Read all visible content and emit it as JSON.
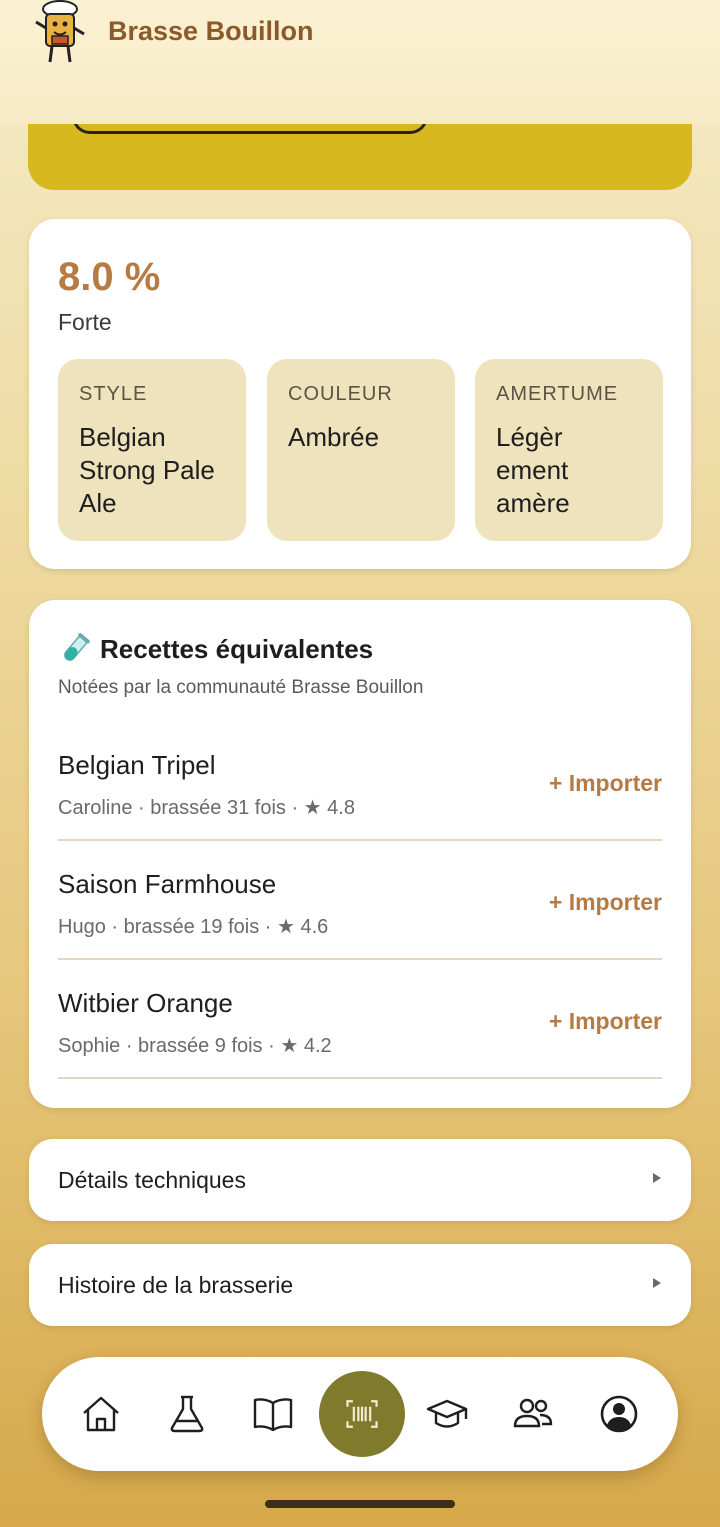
{
  "app": {
    "title": "Brasse Bouillon"
  },
  "beer": {
    "abv": "8.0 %",
    "strength": "Forte",
    "attributes": [
      {
        "label": "STYLE",
        "value": "Belgian Strong Pale Ale"
      },
      {
        "label": "COULEUR",
        "value": "Ambrée"
      },
      {
        "label": "AMERTUME",
        "value": "Légèr ement amère"
      }
    ]
  },
  "recipes": {
    "title": "Recettes équivalentes",
    "subtitle": "Notées par la communauté Brasse Bouillon",
    "import_label": "+ Importer",
    "items": [
      {
        "name": "Belgian Tripel",
        "meta": "Caroline · brassée 31 fois · ★ 4.8"
      },
      {
        "name": "Saison Farmhouse",
        "meta": "Hugo · brassée 19 fois · ★ 4.6"
      },
      {
        "name": "Witbier Orange",
        "meta": "Sophie · brassée 9 fois · ★ 4.2"
      }
    ]
  },
  "sections": {
    "technical": "Détails techniques",
    "history": "Histoire de la brasserie"
  },
  "nav": {
    "items": [
      "home-icon",
      "flask-icon",
      "book-icon",
      "barcode-scan-icon",
      "graduation-cap-icon",
      "community-icon",
      "profile-icon"
    ],
    "active": "barcode-scan-icon"
  },
  "colors": {
    "brand": "#8a5a2b",
    "accent": "#b57b43",
    "scan_button": "#7f7a2c",
    "tile_bg": "#efe3bd",
    "yellow_card": "#d8b81f"
  }
}
